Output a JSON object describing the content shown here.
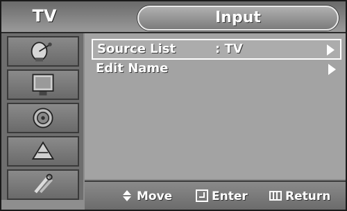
{
  "header": {
    "tv_label": "TV",
    "title": "Input"
  },
  "sidebar": {
    "items": [
      {
        "icon": "satellite-dish-icon"
      },
      {
        "icon": "display-icon"
      },
      {
        "icon": "sound-speaker-icon"
      },
      {
        "icon": "channel-icon"
      },
      {
        "icon": "setup-tools-icon"
      }
    ]
  },
  "menu": {
    "rows": [
      {
        "label": "Source List",
        "value": ":  TV",
        "selected": true
      },
      {
        "label": "Edit Name",
        "value": "",
        "selected": false
      }
    ]
  },
  "footer": {
    "move": "Move",
    "enter": "Enter",
    "return": "Return"
  }
}
